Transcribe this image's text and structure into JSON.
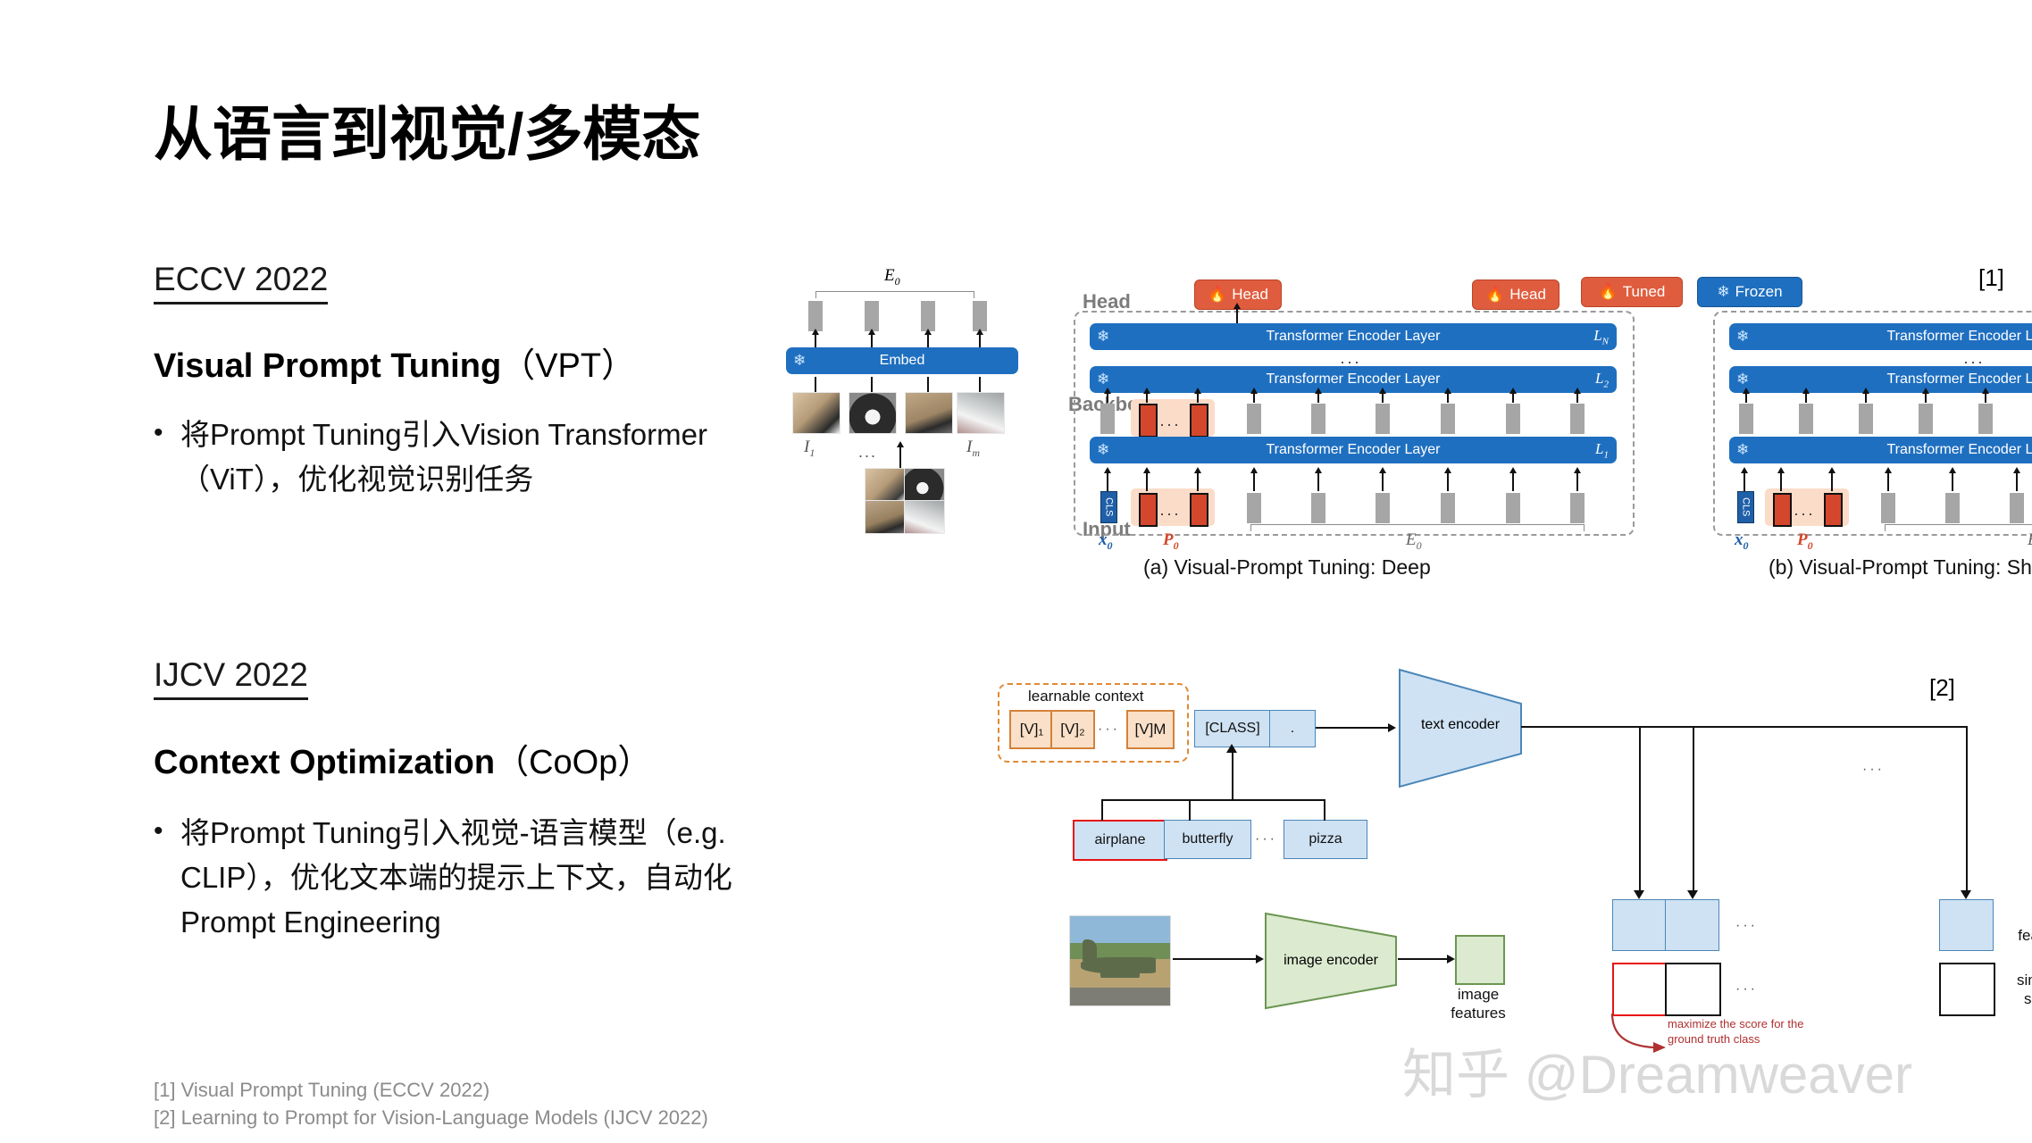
{
  "slide": {
    "title": "从语言到视觉/多模态",
    "watermark": "知乎 @Dreamweaver"
  },
  "sections": [
    {
      "venue": "ECCV 2022",
      "paper_title_bold": "Visual Prompt Tuning",
      "paper_title_paren": "（VPT）",
      "bullet_marker": "•",
      "bullet_text": "将Prompt Tuning引入Vision Transformer（ViT），优化视觉识别任务"
    },
    {
      "venue": "IJCV 2022",
      "paper_title_bold": "Context Optimization",
      "paper_title_paren": "（CoOp）",
      "bullet_marker": "•",
      "bullet_text": "将Prompt Tuning引入视觉-语言模型（e.g. CLIP），优化文本端的提示上下文，自动化Prompt Engineering"
    }
  ],
  "footnotes": [
    "[1] Visual Prompt Tuning (ECCV 2022)",
    "[2] Learning to Prompt for Vision-Language Models (IJCV 2022)"
  ],
  "figure_vpt": {
    "ref_tag": "[1]",
    "side_labels": [
      "Head",
      "Backbone",
      "Input"
    ],
    "legend": [
      {
        "label": "Tuned",
        "icon": "fire-icon",
        "color": "#e05c3e"
      },
      {
        "label": "Frozen",
        "icon": "snowflake-icon",
        "color": "#1f6fc0"
      }
    ],
    "head_chip": {
      "label": "Head",
      "icon": "fire-icon",
      "color": "#e05c3e"
    },
    "encoder_layer_label": "Transformer Encoder Layer",
    "layer_indices": {
      "top": "L",
      "top_sub": "N",
      "mid": "L",
      "mid_sub": "2",
      "bottom": "L",
      "bottom_sub": "1"
    },
    "embed_label": "Embed",
    "embed_icon": "snowflake-icon",
    "embed_outputs_label": "E",
    "embed_outputs_sub": "0",
    "image_labels": {
      "first": "I",
      "first_sub": "1",
      "last": "I",
      "last_sub": "m",
      "ellipsis": "..."
    },
    "cls_token_label": "CLS",
    "input_labels": {
      "x": "x",
      "x_sub": "0",
      "p": "P",
      "p_sub": "0",
      "e": "E",
      "e_sub": "0"
    },
    "ellipsis": "···",
    "captions": [
      "(a) Visual-Prompt Tuning:  Deep",
      "(b) Visual-Prompt Tuning:  Shallow"
    ]
  },
  "figure_coop": {
    "ref_tag": "[2]",
    "learnable_context_label": "learnable context",
    "context_tokens": [
      "[V]₁",
      "[V]₂",
      "[V]M"
    ],
    "context_ellipsis": "···",
    "class_token": "[CLASS]",
    "period_token": ".",
    "class_names": [
      "airplane",
      "butterfly",
      "pizza"
    ],
    "class_ellipsis": "···",
    "text_encoder_label": "text encoder",
    "image_encoder_label": "image encoder",
    "image_features_label": "image\nfeatures",
    "text_features_label": "text\nfeatures",
    "similarity_scores_label": "similarity\nscores",
    "annotation": "maximize the score for the\nground truth class",
    "feature_ellipsis": "···",
    "top_ellipsis": "···"
  },
  "colors": {
    "blue_bar": "#1f6fc0",
    "tuned_red": "#e05c3e",
    "prompt_red": "#d4472c",
    "prompt_bg": "#fbdcc9",
    "coop_blue_fill": "#cfe2f3",
    "coop_blue_border": "#4a86b8",
    "coop_orange_fill": "#fae0c8",
    "coop_orange_border": "#d4813a",
    "coop_green_fill": "#dcead0",
    "coop_green_border": "#6b9651",
    "highlight_red": "#e81313",
    "footnote_gray": "#8b8b8b",
    "watermark_gray": "#d9d9d9"
  }
}
